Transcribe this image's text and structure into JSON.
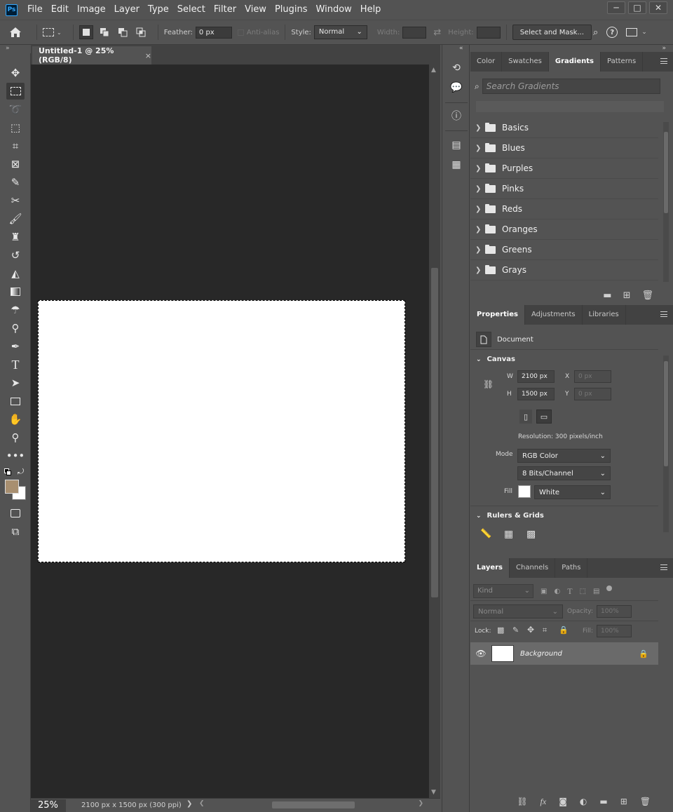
{
  "app": {
    "logo_text": "Ps",
    "menu": [
      "File",
      "Edit",
      "Image",
      "Layer",
      "Type",
      "Select",
      "Filter",
      "View",
      "Plugins",
      "Window",
      "Help"
    ],
    "window_controls": {
      "minimize": "─",
      "maximize": "□",
      "close": "✕"
    }
  },
  "options_bar": {
    "feather_label": "Feather:",
    "feather_value": "0 px",
    "antialias_label": "Anti-alias",
    "style_label": "Style:",
    "style_value": "Normal",
    "width_label": "Width:",
    "height_label": "Height:",
    "select_mask_label": "Select and Mask..."
  },
  "document": {
    "tab_title": "Untitled-1 @ 25% (RGB/8)",
    "tab_close": "×",
    "zoom": "25%",
    "doc_info": "2100 px x 1500 px (300 ppi)"
  },
  "gradients_panel": {
    "tabs": [
      "Color",
      "Swatches",
      "Gradients",
      "Patterns"
    ],
    "active_tab": "Gradients",
    "search_placeholder": "Search Gradients",
    "folders": [
      "Basics",
      "Blues",
      "Purples",
      "Pinks",
      "Reds",
      "Oranges",
      "Greens",
      "Grays"
    ]
  },
  "properties_panel": {
    "tabs": [
      "Properties",
      "Adjustments",
      "Libraries"
    ],
    "active_tab": "Properties",
    "doc_label": "Document",
    "canvas_section": "Canvas",
    "w_label": "W",
    "w_value": "2100 px",
    "h_label": "H",
    "h_value": "1500 px",
    "x_label": "X",
    "x_value": "0 px",
    "y_label": "Y",
    "y_value": "0 px",
    "resolution": "Resolution: 300 pixels/inch",
    "mode_label": "Mode",
    "mode_value": "RGB Color",
    "depth_value": "8 Bits/Channel",
    "fill_label": "Fill",
    "fill_value": "White",
    "rulers_section": "Rulers & Grids"
  },
  "layers_panel": {
    "tabs": [
      "Layers",
      "Channels",
      "Paths"
    ],
    "active_tab": "Layers",
    "kind_label": "Kind",
    "blend_mode": "Normal",
    "opacity_label": "Opacity:",
    "opacity_value": "100%",
    "lock_label": "Lock:",
    "fill_label": "Fill:",
    "fill_value": "100%",
    "layers": [
      {
        "name": "Background",
        "locked": true,
        "visible": true
      }
    ]
  },
  "colors": {
    "foreground": "#a88f70",
    "background": "#ffffff"
  }
}
